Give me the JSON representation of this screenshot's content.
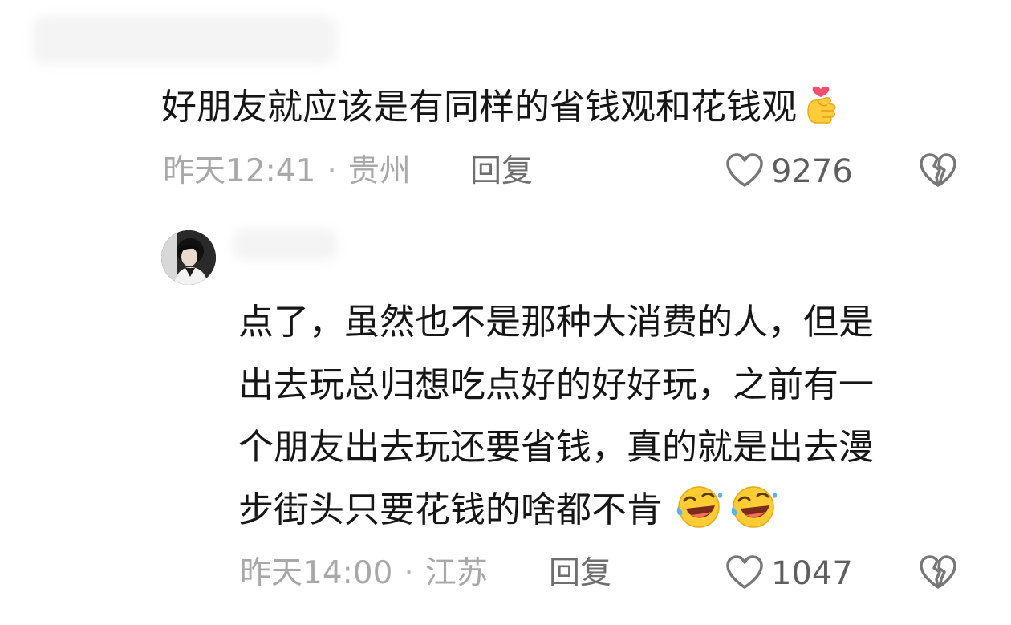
{
  "comments": [
    {
      "text": "好朋友就应该是有同样的省钱观和花钱观",
      "emoji_icon": "finger-heart-emoji",
      "time": "昨天12:41",
      "location": "贵州",
      "separator": "·",
      "reply_label": "回复",
      "like_count": "9276",
      "like_icon": "heart-outline-icon",
      "dislike_icon": "broken-heart-icon"
    },
    {
      "avatar_icon": "user-avatar-photo",
      "lines": [
        "点了，虽然也不是那种大消费的人，但是",
        "出去玩总归想吃点好的好好玩，之前有一",
        "个朋友出去玩还要省钱，真的就是出去漫",
        "步街头只要花钱的啥都不肯"
      ],
      "emoji_icons": [
        "rolling-laughing-emoji",
        "rolling-laughing-emoji"
      ],
      "time": "昨天14:00",
      "location": "江苏",
      "separator": "·",
      "reply_label": "回复",
      "like_count": "1047",
      "like_icon": "heart-outline-icon",
      "dislike_icon": "broken-heart-icon"
    }
  ],
  "colors": {
    "text": "#161616",
    "meta": "#a8a8a8",
    "reply": "#6f6f6f",
    "count": "#5e5e5e",
    "icon_stroke": "#777777"
  }
}
